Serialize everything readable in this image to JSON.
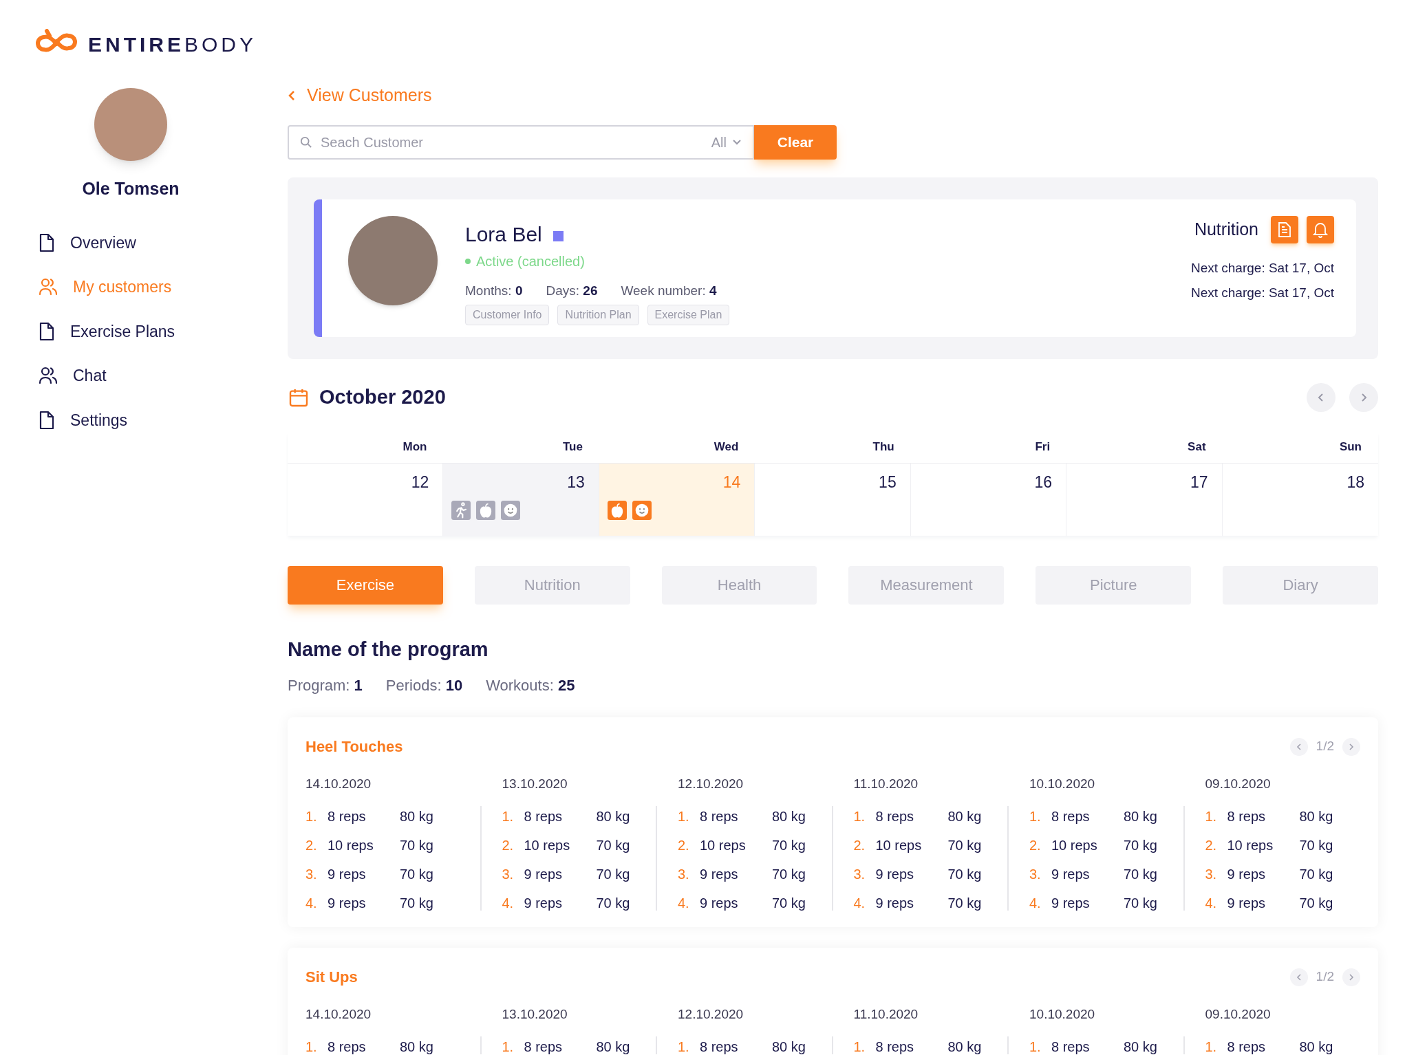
{
  "logo": {
    "strong": "ENTIRE",
    "light": "BODY"
  },
  "user": {
    "name": "Ole Tomsen"
  },
  "nav": [
    {
      "label": "Overview",
      "kind": "document",
      "selected": false
    },
    {
      "label": "My customers",
      "kind": "users",
      "selected": true
    },
    {
      "label": "Exercise Plans",
      "kind": "document",
      "selected": false
    },
    {
      "label": "Chat",
      "kind": "users",
      "selected": false
    },
    {
      "label": "Settings",
      "kind": "document",
      "selected": false
    }
  ],
  "back_link": "View Customers",
  "search": {
    "placeholder": "Seach Customer",
    "filter": "All",
    "clear_button": "Clear"
  },
  "customer": {
    "name": "Lora Bel",
    "status": "Active (cancelled)",
    "stats": [
      {
        "label": "Months:",
        "value": "0"
      },
      {
        "label": "Days:",
        "value": "26"
      },
      {
        "label": "Week number:",
        "value": "4"
      }
    ],
    "tags": [
      "Customer Info",
      "Nutrition Plan",
      "Exercise Plan"
    ],
    "plan": "Nutrition",
    "charges": [
      "Next charge: Sat 17, Oct",
      "Next charge: Sat 17, Oct"
    ]
  },
  "calendar": {
    "title": "October 2020",
    "days": [
      {
        "weekday": "Mon",
        "date": "12",
        "kind": "plain",
        "selected": false
      },
      {
        "weekday": "Tue",
        "date": "13",
        "kind": "shaded",
        "selected": false,
        "icons": [
          {
            "kind": "run"
          },
          {
            "kind": "apple"
          },
          {
            "kind": "smile"
          }
        ]
      },
      {
        "weekday": "Wed",
        "date": "14",
        "kind": "plain",
        "selected": true,
        "icons": [
          {
            "kind": "apple"
          },
          {
            "kind": "smile"
          }
        ]
      },
      {
        "weekday": "Thu",
        "date": "15",
        "kind": "plain",
        "selected": false
      },
      {
        "weekday": "Fri",
        "date": "16",
        "kind": "plain",
        "selected": false
      },
      {
        "weekday": "Sat",
        "date": "17",
        "kind": "plain",
        "selected": false
      },
      {
        "weekday": "Sun",
        "date": "18",
        "kind": "plain",
        "selected": false
      }
    ]
  },
  "tabs": [
    {
      "label": "Exercise",
      "selected": true
    },
    {
      "label": "Nutrition",
      "selected": false
    },
    {
      "label": "Health",
      "selected": false
    },
    {
      "label": "Measurement",
      "selected": false
    },
    {
      "label": "Picture",
      "selected": false
    },
    {
      "label": "Diary",
      "selected": false
    }
  ],
  "program": {
    "title": "Name of the program",
    "stats": [
      {
        "label": "Program:",
        "value": "1"
      },
      {
        "label": "Periods:",
        "value": "10"
      },
      {
        "label": "Workouts:",
        "value": "25"
      }
    ]
  },
  "exercises": [
    {
      "name": "Heel Touches",
      "page": "1/2",
      "sessions": [
        {
          "date": "14.10.2020",
          "sets": [
            {
              "number": "1.",
              "reps": "8 reps",
              "weight": "80 kg"
            },
            {
              "number": "2.",
              "reps": "10 reps",
              "weight": "70 kg"
            },
            {
              "number": "3.",
              "reps": "9 reps",
              "weight": "70 kg"
            },
            {
              "number": "4.",
              "reps": "9 reps",
              "weight": "70 kg"
            }
          ]
        },
        {
          "date": "13.10.2020",
          "sets": [
            {
              "number": "1.",
              "reps": "8 reps",
              "weight": "80 kg"
            },
            {
              "number": "2.",
              "reps": "10 reps",
              "weight": "70 kg"
            },
            {
              "number": "3.",
              "reps": "9 reps",
              "weight": "70 kg"
            },
            {
              "number": "4.",
              "reps": "9 reps",
              "weight": "70 kg"
            }
          ]
        },
        {
          "date": "12.10.2020",
          "sets": [
            {
              "number": "1.",
              "reps": "8 reps",
              "weight": "80 kg"
            },
            {
              "number": "2.",
              "reps": "10 reps",
              "weight": "70 kg"
            },
            {
              "number": "3.",
              "reps": "9 reps",
              "weight": "70 kg"
            },
            {
              "number": "4.",
              "reps": "9 reps",
              "weight": "70 kg"
            }
          ]
        },
        {
          "date": "11.10.2020",
          "sets": [
            {
              "number": "1.",
              "reps": "8 reps",
              "weight": "80 kg"
            },
            {
              "number": "2.",
              "reps": "10 reps",
              "weight": "70 kg"
            },
            {
              "number": "3.",
              "reps": "9 reps",
              "weight": "70 kg"
            },
            {
              "number": "4.",
              "reps": "9 reps",
              "weight": "70 kg"
            }
          ]
        },
        {
          "date": "10.10.2020",
          "sets": [
            {
              "number": "1.",
              "reps": "8 reps",
              "weight": "80 kg"
            },
            {
              "number": "2.",
              "reps": "10 reps",
              "weight": "70 kg"
            },
            {
              "number": "3.",
              "reps": "9 reps",
              "weight": "70 kg"
            },
            {
              "number": "4.",
              "reps": "9 reps",
              "weight": "70 kg"
            }
          ]
        },
        {
          "date": "09.10.2020",
          "sets": [
            {
              "number": "1.",
              "reps": "8 reps",
              "weight": "80 kg"
            },
            {
              "number": "2.",
              "reps": "10 reps",
              "weight": "70 kg"
            },
            {
              "number": "3.",
              "reps": "9 reps",
              "weight": "70 kg"
            },
            {
              "number": "4.",
              "reps": "9 reps",
              "weight": "70 kg"
            }
          ]
        }
      ]
    },
    {
      "name": "Sit Ups",
      "page": "1/2",
      "sessions": [
        {
          "date": "14.10.2020",
          "sets": [
            {
              "number": "1.",
              "reps": "8 reps",
              "weight": "80 kg"
            }
          ]
        },
        {
          "date": "13.10.2020",
          "sets": [
            {
              "number": "1.",
              "reps": "8 reps",
              "weight": "80 kg"
            }
          ]
        },
        {
          "date": "12.10.2020",
          "sets": [
            {
              "number": "1.",
              "reps": "8 reps",
              "weight": "80 kg"
            }
          ]
        },
        {
          "date": "11.10.2020",
          "sets": [
            {
              "number": "1.",
              "reps": "8 reps",
              "weight": "80 kg"
            }
          ]
        },
        {
          "date": "10.10.2020",
          "sets": [
            {
              "number": "1.",
              "reps": "8 reps",
              "weight": "80 kg"
            }
          ]
        },
        {
          "date": "09.10.2020",
          "sets": [
            {
              "number": "1.",
              "reps": "8 reps",
              "weight": "80 kg"
            }
          ]
        }
      ]
    }
  ]
}
